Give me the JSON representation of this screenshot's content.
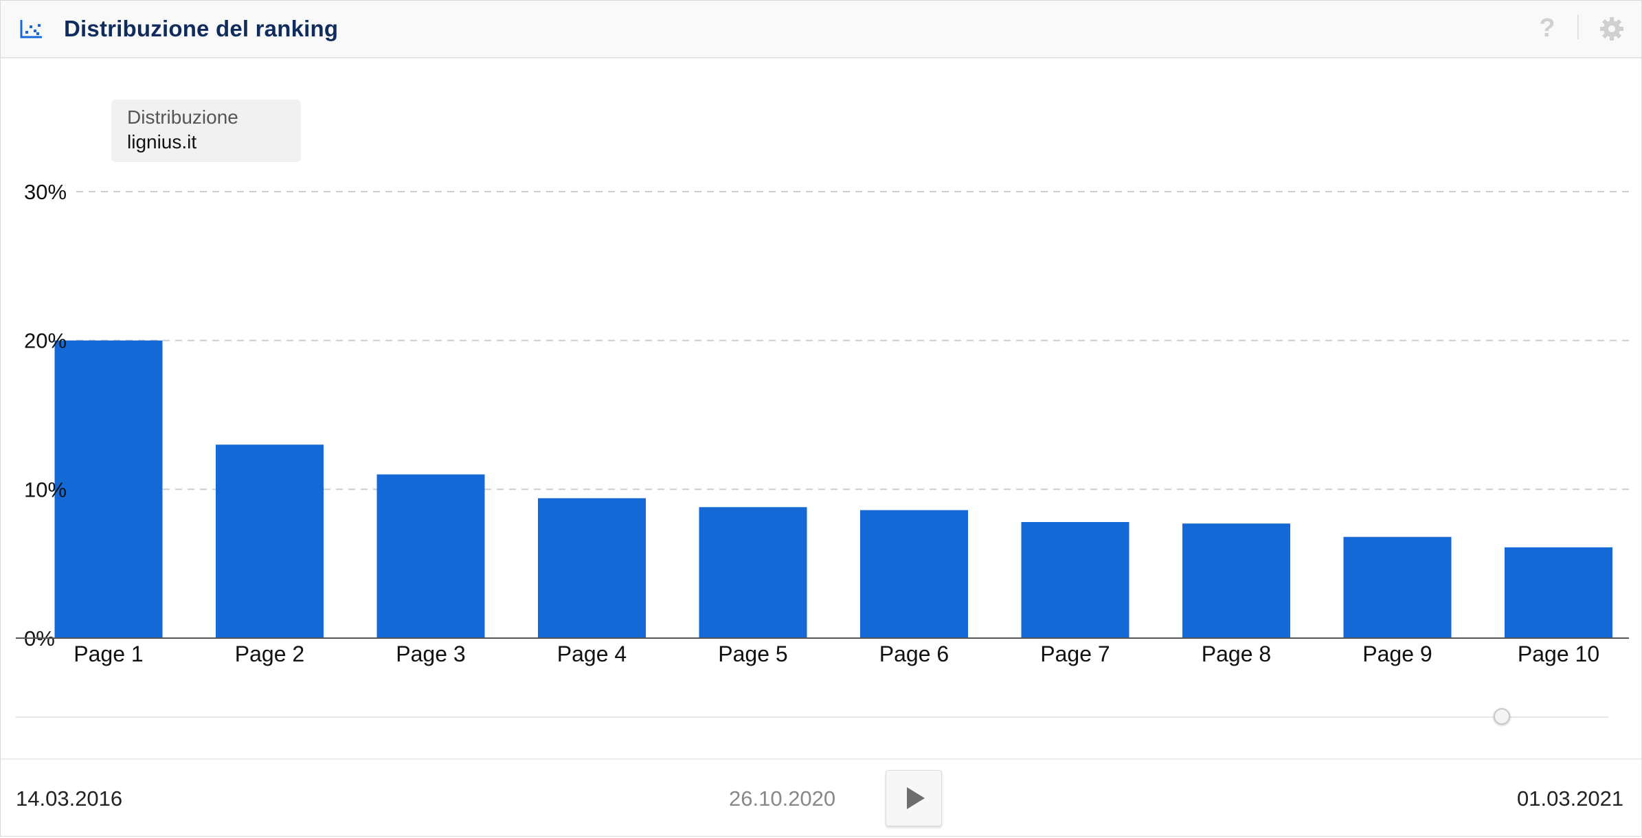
{
  "header": {
    "title": "Distribuzione del ranking",
    "chart_icon": "scatter-chart-icon",
    "help_icon": "question-mark-icon",
    "help_label": "?",
    "settings_icon": "gear-icon"
  },
  "legend": {
    "title": "Distribuzione",
    "series": "lignius.it"
  },
  "colors": {
    "bar": "#1469d6",
    "header_title": "#0f2c5c",
    "grid": "#cccccc",
    "axis": "#555555"
  },
  "chart_data": {
    "type": "bar",
    "title": "",
    "xlabel": "",
    "ylabel": "",
    "categories": [
      "Page 1",
      "Page 2",
      "Page 3",
      "Page 4",
      "Page 5",
      "Page 6",
      "Page 7",
      "Page 8",
      "Page 9",
      "Page 10"
    ],
    "series": [
      {
        "name": "lignius.it",
        "values": [
          20.0,
          13.0,
          11.0,
          9.4,
          8.8,
          8.6,
          7.8,
          7.7,
          6.8,
          6.1
        ]
      }
    ],
    "ylim": [
      0,
      30
    ],
    "yticks": [
      0,
      10,
      20,
      30
    ],
    "ytick_labels": [
      "0%",
      "10%",
      "20%",
      "30%"
    ],
    "grid": true,
    "legend_position": "top-left"
  },
  "timeline": {
    "start_date": "14.03.2016",
    "current_date": "26.10.2020",
    "end_date": "01.03.2021",
    "play_icon": "play-icon"
  }
}
